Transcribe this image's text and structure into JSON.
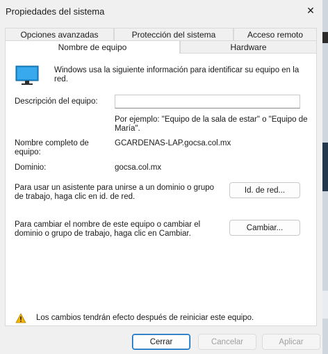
{
  "window": {
    "title": "Propiedades del sistema",
    "close_glyph": "✕"
  },
  "tabs": {
    "row1": [
      "Opciones avanzadas",
      "Protección del sistema",
      "Acceso remoto"
    ],
    "row2": [
      "Nombre de equipo",
      "Hardware"
    ],
    "active": "Nombre de equipo"
  },
  "panel": {
    "intro": "Windows usa la siguiente información para identificar su equipo en la red.",
    "description_label": "Descripción del equipo:",
    "description_value": "",
    "example_text": "Por ejemplo: \"Equipo de la sala de estar\" o \"Equipo de María\".",
    "full_name_label": "Nombre completo de equipo:",
    "full_name_value": "GCARDENAS-LAP.gocsa.col.mx",
    "domain_label": "Dominio:",
    "domain_value": "gocsa.col.mx",
    "network_id_text": "Para usar un asistente para unirse a un dominio o grupo de trabajo, haga clic en id. de red.",
    "network_id_button": "Id. de red...",
    "change_text": "Para cambiar el nombre de este equipo o cambiar el dominio o grupo de trabajo, haga clic en Cambiar.",
    "change_button": "Cambiar...",
    "warning_text": "Los cambios tendrán efecto después de reiniciar este equipo."
  },
  "buttons": {
    "close": "Cerrar",
    "cancel": "Cancelar",
    "apply": "Aplicar"
  },
  "icons": {
    "computer": "computer-monitor-icon",
    "warning": "warning-icon",
    "close": "close-icon"
  },
  "colors": {
    "accent": "#0067c0",
    "monitor_screen": "#1e90d6",
    "warning": "#f4b400"
  }
}
